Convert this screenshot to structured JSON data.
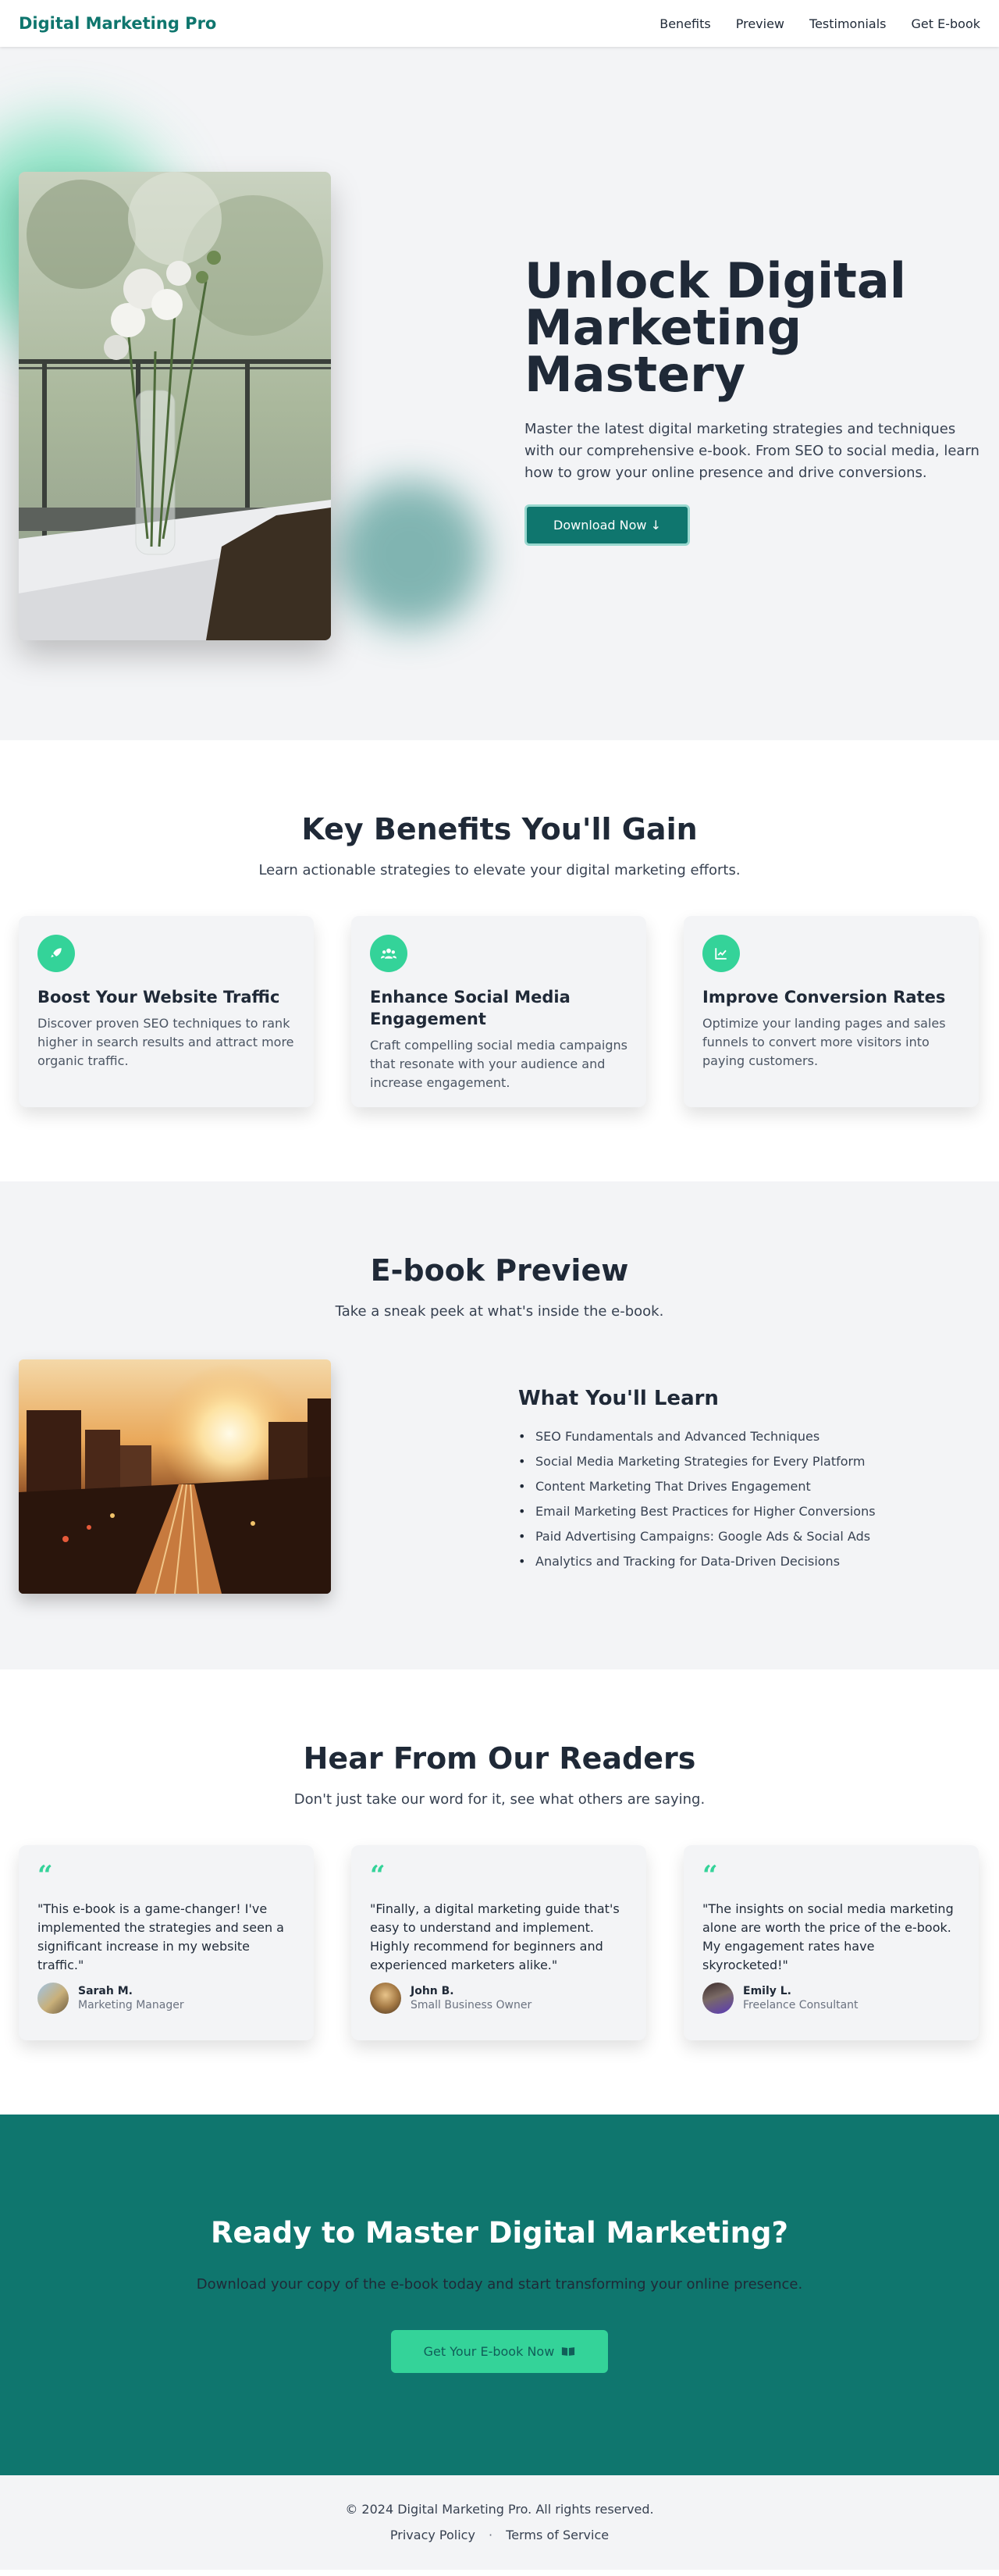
{
  "nav": {
    "brand": "Digital Marketing Pro",
    "links": [
      "Benefits",
      "Preview",
      "Testimonials",
      "Get E-book"
    ]
  },
  "hero": {
    "title": "Unlock Digital Marketing Mastery",
    "description": "Master the latest digital marketing strategies and techniques with our comprehensive e-book. From SEO to social media, learn how to grow your online presence and drive conversions.",
    "button_label": "Download Now",
    "button_icon": "arrow-down-icon"
  },
  "benefits": {
    "title": "Key Benefits You'll Gain",
    "subtitle": "Learn actionable strategies to elevate your digital marketing efforts.",
    "cards": [
      {
        "icon": "rocket-icon",
        "title": "Boost Your Website Traffic",
        "description": "Discover proven SEO techniques to rank higher in search results and attract more organic traffic."
      },
      {
        "icon": "users-icon",
        "title": "Enhance Social Media Engagement",
        "description": "Craft compelling social media campaigns that resonate with your audience and increase engagement."
      },
      {
        "icon": "chart-line-icon",
        "title": "Improve Conversion Rates",
        "description": "Optimize your landing pages and sales funnels to convert more visitors into paying customers."
      }
    ]
  },
  "preview": {
    "title": "E-book Preview",
    "subtitle": "Take a sneak peek at what's inside the e-book.",
    "learn_title": "What You'll Learn",
    "learn_items": [
      "SEO Fundamentals and Advanced Techniques",
      "Social Media Marketing Strategies for Every Platform",
      "Content Marketing That Drives Engagement",
      "Email Marketing Best Practices for Higher Conversions",
      "Paid Advertising Campaigns: Google Ads & Social Ads",
      "Analytics and Tracking for Data-Driven Decisions"
    ]
  },
  "testimonials": {
    "title": "Hear From Our Readers",
    "subtitle": "Don't just take our word for it, see what others are saying.",
    "items": [
      {
        "quote": "\"This e-book is a game-changer! I've implemented the strategies and seen a significant increase in my website traffic.\"",
        "name": "Sarah M.",
        "role": "Marketing Manager"
      },
      {
        "quote": "\"Finally, a digital marketing guide that's easy to understand and implement. Highly recommend for beginners and experienced marketers alike.\"",
        "name": "John B.",
        "role": "Small Business Owner"
      },
      {
        "quote": "\"The insights on social media marketing alone are worth the price of the e-book. My engagement rates have skyrocketed!\"",
        "name": "Emily L.",
        "role": "Freelance Consultant"
      }
    ]
  },
  "cta": {
    "title": "Ready to Master Digital Marketing?",
    "subtitle": "Download your copy of the e-book today and start transforming your online presence.",
    "button_label": "Get Your E-book Now",
    "button_icon": "book-open-icon"
  },
  "footer": {
    "copyright": "© 2024 Digital Marketing Pro. All rights reserved.",
    "links": [
      "Privacy Policy",
      "Terms of Service"
    ],
    "separator": "·"
  },
  "colors": {
    "brand": "#0f766e",
    "accent": "#34d399",
    "text": "#1f2937",
    "section_bg": "#f3f4f6"
  }
}
